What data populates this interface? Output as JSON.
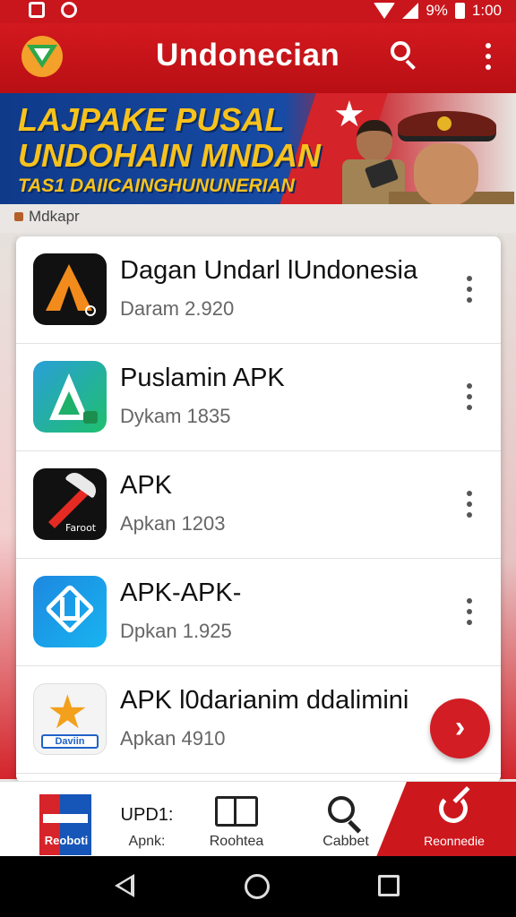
{
  "status_bar": {
    "battery_text": "9%",
    "time": "1:00"
  },
  "app_bar": {
    "title": "Undonecian"
  },
  "banner": {
    "line1": "LAJPAKE PUSAL",
    "line2": "UNDOHAIN MNDAN",
    "line3": "TAS1 DAIICAINGHUNUNERIAN"
  },
  "section_label": "Mdkapr",
  "apps": [
    {
      "title": "Dagan Undarl lUndonesia",
      "subtitle": "Daram 2.920",
      "icon": "orange-a-logo-icon"
    },
    {
      "title": "Puslamin APK",
      "subtitle": "Dykam 1835",
      "icon": "green-a-logo-icon"
    },
    {
      "title": "APK",
      "subtitle": "Apkan 1203",
      "icon": "pickaxe-logo-icon",
      "icon_text": "Faroot"
    },
    {
      "title": "APK-APK-",
      "subtitle": "Dpkan 1.925",
      "icon": "blue-triangle-logo-icon"
    },
    {
      "title": "APK l0darianim ddalimini",
      "subtitle": "Apkan 4910",
      "icon": "star-logo-icon",
      "icon_text": "Daviin"
    }
  ],
  "fab": {
    "glyph": "›"
  },
  "bottom_nav": {
    "home_label": "Reoboti",
    "apps_top": "UPD1:",
    "apps_label": "Apnk:",
    "browse_label": "Roohtea",
    "search_label": "Cabbet",
    "recommend_label": "Reonnedie"
  },
  "colors": {
    "primary_red": "#c8161c",
    "banner_blue": "#174ba5",
    "banner_yellow": "#f8c21c"
  }
}
